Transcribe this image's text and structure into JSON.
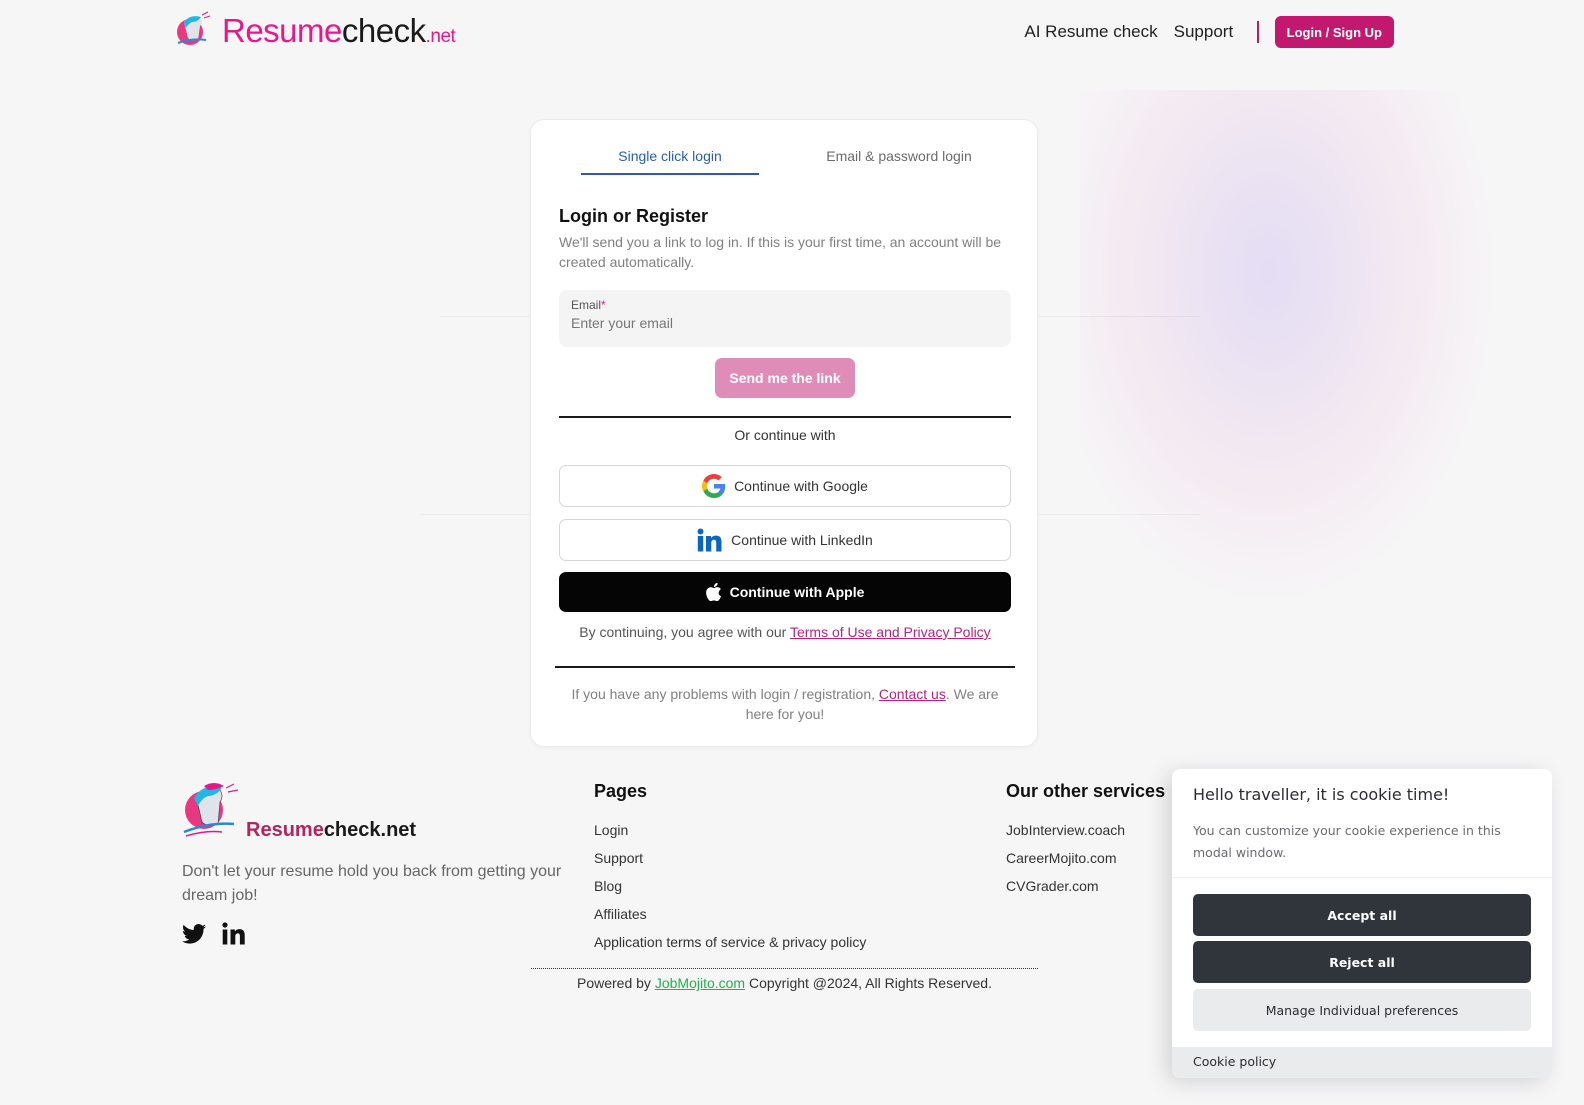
{
  "header": {
    "logo": {
      "part1": "Resume",
      "part2": "check",
      "part3": ".net"
    },
    "nav": [
      {
        "label": "AI Resume check"
      },
      {
        "label": "Support"
      }
    ],
    "login_button": "Login / Sign Up"
  },
  "login_card": {
    "tabs": [
      {
        "label": "Single click login",
        "active": true
      },
      {
        "label": "Email & password login",
        "active": false
      }
    ],
    "title": "Login or Register",
    "intro": "We'll send you a link to log in. If this is your first time, an account will be created automatically.",
    "email": {
      "label": "Email",
      "required_mark": "*",
      "placeholder": "Enter your email",
      "value": ""
    },
    "send_button": "Send me the link",
    "divider_text": "Or continue with",
    "social": {
      "google": "Continue with Google",
      "linkedin": "Continue with LinkedIn",
      "apple": "Continue with Apple"
    },
    "terms_prefix": "By continuing, you agree with our ",
    "terms_link": "Terms of Use and Privacy Policy",
    "problems_prefix": "If you have any problems with login / registration, ",
    "problems_link": "Contact us",
    "problems_suffix": ". We are here for you!"
  },
  "footer": {
    "logo": {
      "part1": "Resume",
      "part2": "check.net"
    },
    "tagline": "Don't let your resume hold you back from getting your dream job!",
    "pages": {
      "title": "Pages",
      "links": [
        "Login",
        "Support",
        "Blog",
        "Affiliates",
        "Application terms of service & privacy policy"
      ]
    },
    "services": {
      "title": "Our other services",
      "links": [
        "JobInterview.coach",
        "CareerMojito.com",
        "CVGrader.com"
      ]
    },
    "copyright_prefix": "Powered by ",
    "copyright_link": "JobMojito.com",
    "copyright_suffix": " Copyright @2024, All Rights Reserved."
  },
  "cookie_modal": {
    "title": "Hello traveller, it is cookie time!",
    "description": "You can customize your cookie experience in this modal window.",
    "accept": "Accept all",
    "reject": "Reject all",
    "manage": "Manage Individual preferences",
    "policy": "Cookie policy"
  },
  "colors": {
    "brand_pink": "#e5198a",
    "button_magenta": "#c2186f",
    "tab_active": "#2a5db0",
    "link_green": "#22b24c"
  }
}
